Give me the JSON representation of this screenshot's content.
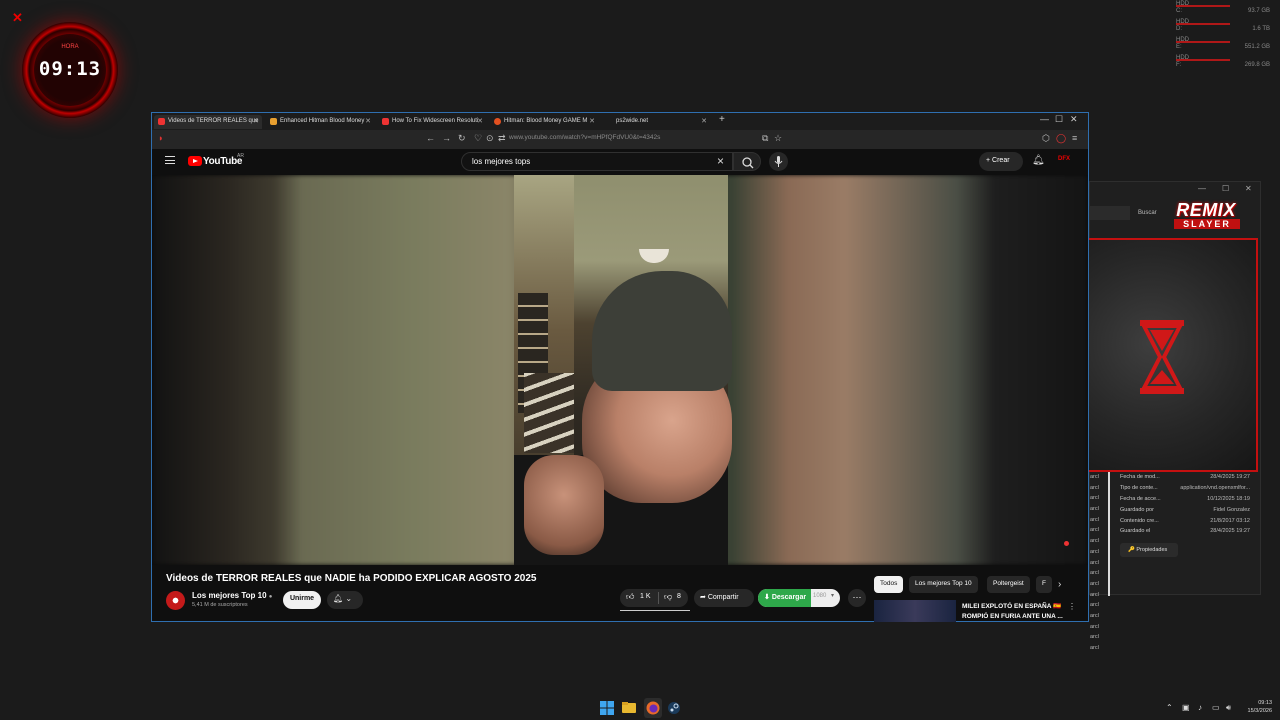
{
  "desktop": {
    "clock_top_label": "HORA",
    "clock_time": "09:13",
    "drives": [
      {
        "type": "HDD",
        "letter": "C:",
        "size": "93.7 GB"
      },
      {
        "type": "HDD",
        "letter": "D:",
        "size": "1.6 TB"
      },
      {
        "type": "HDD",
        "letter": "E:",
        "size": "551.2 GB"
      },
      {
        "type": "HDD",
        "letter": "F:",
        "size": "269.8 GB"
      }
    ]
  },
  "browser": {
    "tabs": [
      {
        "label": "Videos de TERROR REALES que",
        "color": "#e33"
      },
      {
        "label": "Enhanced Hitman Blood Money",
        "color": "#e8a030"
      },
      {
        "label": "How To Fix Widescreen Resoluti",
        "color": "#e33"
      },
      {
        "label": "Hitman: Blood Money GAME M",
        "color": "#e25020"
      },
      {
        "label": "ps2wide.net",
        "color": "#444"
      }
    ],
    "new_tab": "+",
    "url": "www.youtube.com/watch?v=mHPfQFdVU0&t=4342s"
  },
  "youtube": {
    "logo_text": "YouTube",
    "country": "AR",
    "search_value": "los mejores tops",
    "create_label": "Crear",
    "avatar_text": "DFX",
    "video_title": "Videos de TERROR REALES que NADIE ha PODIDO EXPLICAR AGOSTO 2025",
    "channel_name": "Los mejores Top 10",
    "channel_subs": "5,41 M de suscriptores",
    "join_label": "Unirme",
    "likes": "1 K",
    "dislikes": "8",
    "share_label": "Compartir",
    "download_label": "Descargar",
    "download_quality": "1080",
    "chips": [
      "Todos",
      "Los mejores Top 10",
      "Poltergeist",
      "F"
    ],
    "recommended_title": "MILEI EXPLOTÓ EN ESPAÑA 🇪🇸 ROMPIÓ EN FURIA ANTE UNA ..."
  },
  "explorer": {
    "search_label": "Buscar",
    "list_items": [
      "arcl",
      "arcl",
      "arcl",
      "arcl",
      "arcl",
      "arcl",
      "arcl",
      "arcl",
      "arcl",
      "arcl",
      "arcl",
      "arcl",
      "arcl",
      "arcl",
      "arcl",
      "arcl",
      "arcl"
    ],
    "properties": [
      {
        "key": "Fecha de mod...",
        "value": "28/4/2025 19:27"
      },
      {
        "key": "Tipo de conte...",
        "value": "application/vnd.openxmlfor..."
      },
      {
        "key": "Fecha de acce...",
        "value": "10/12/2025 18:19"
      },
      {
        "key": "Guardado por",
        "value": "Fidel Gonzalez"
      },
      {
        "key": "Contenido cre...",
        "value": "21/8/2017 03:12"
      },
      {
        "key": "Guardado el",
        "value": "28/4/2025 19:27"
      }
    ],
    "properties_button": "Propiedades"
  },
  "overlay": {
    "logo_top": "REMIX",
    "logo_bottom": "SLAYER"
  },
  "taskbar": {
    "time": "09:13",
    "date": "15/3/2026"
  }
}
